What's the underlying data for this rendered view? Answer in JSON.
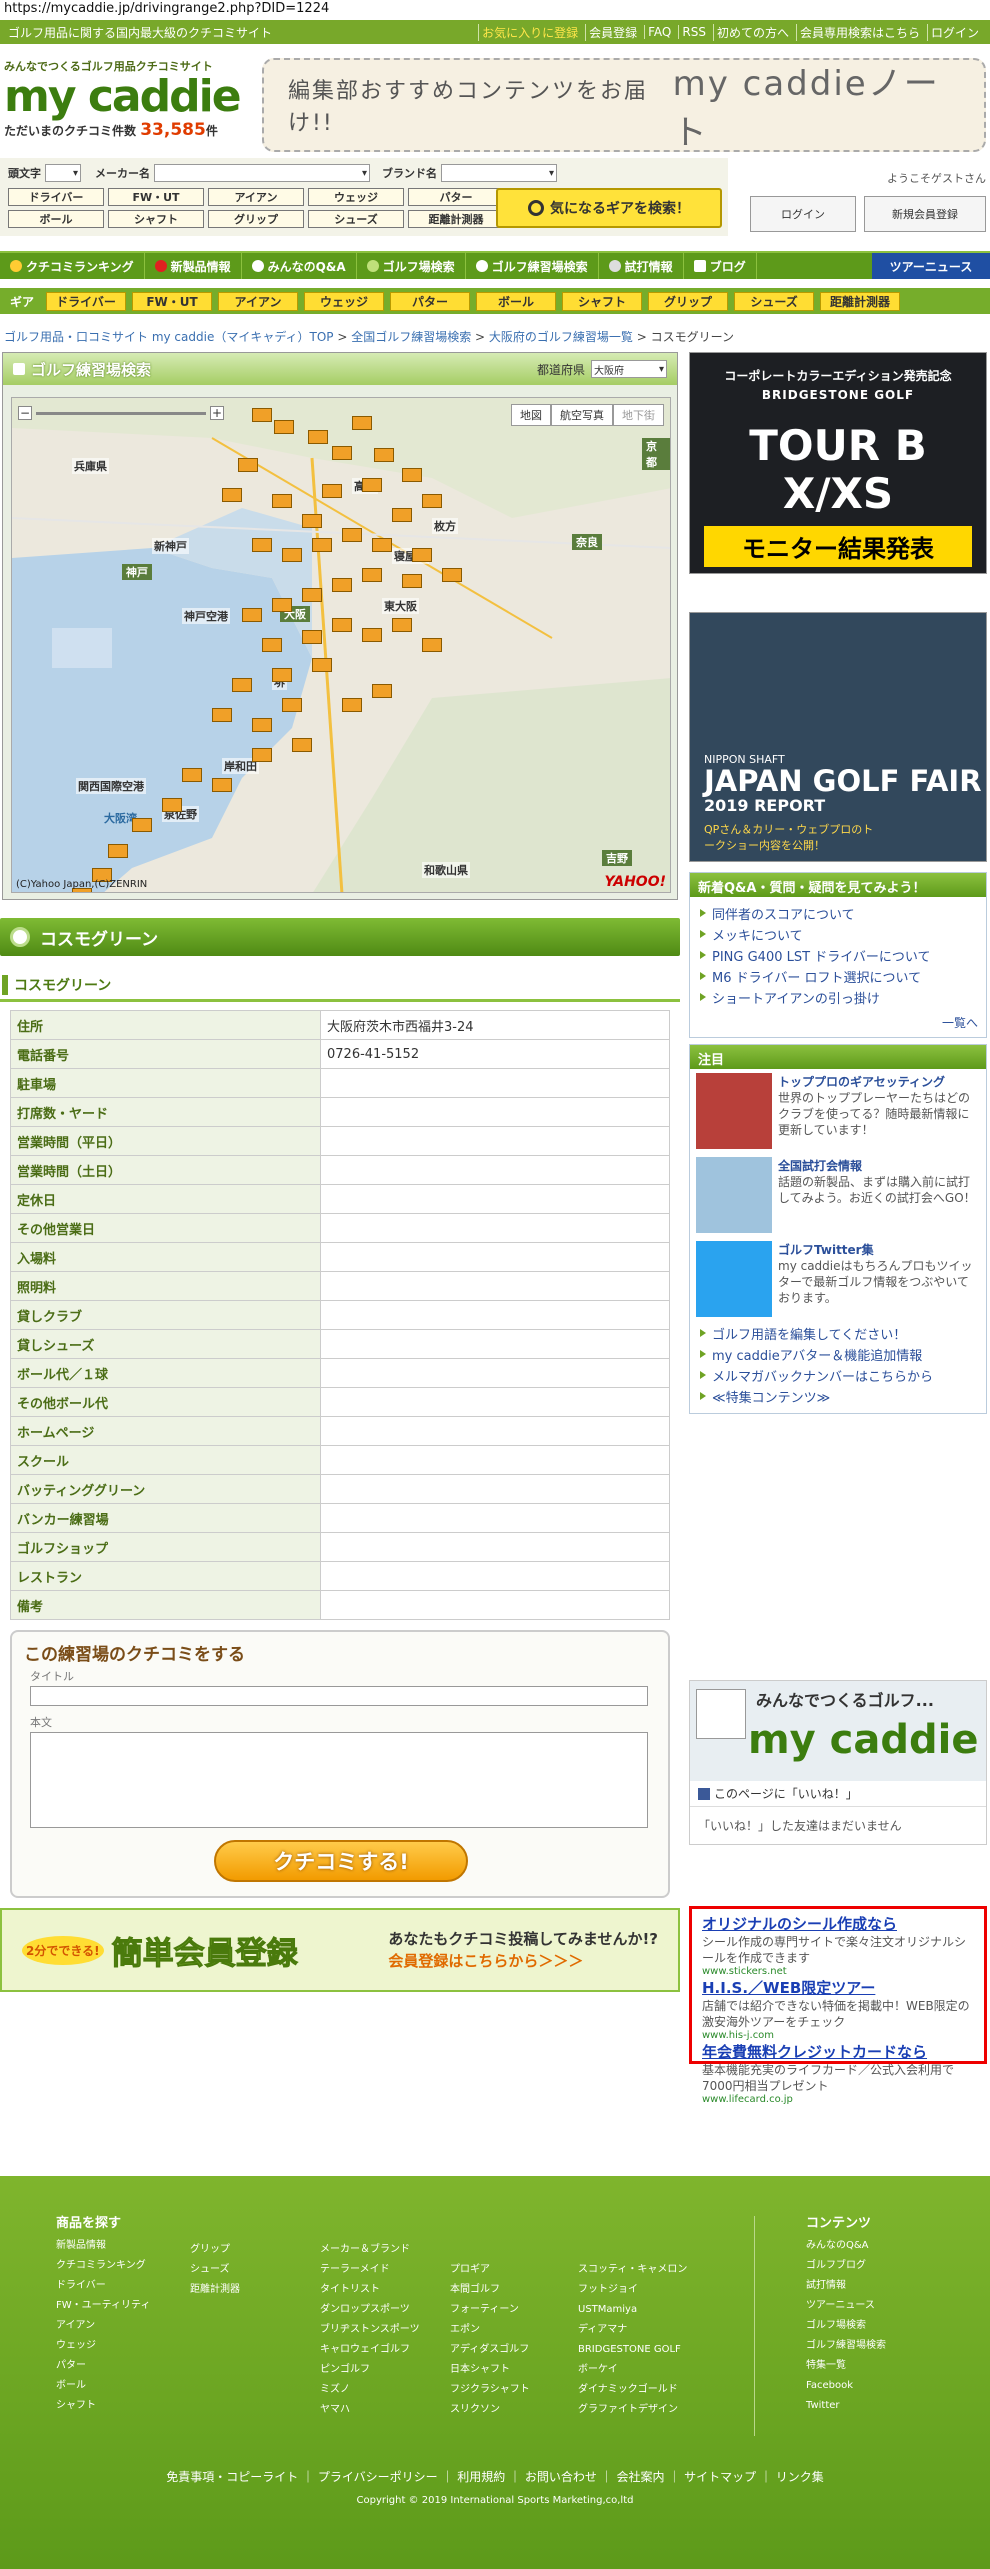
{
  "browser": {
    "url": "https://mycaddie.jp/drivingrange2.php?DID=1224"
  },
  "topbar": {
    "tagline": "ゴルフ用品に関する国内最大級のクチコミサイト",
    "links": [
      "お気に入りに登録",
      "会員登録",
      "FAQ",
      "RSS",
      "初めての方へ",
      "会員専用検索はこちら",
      "ログイン"
    ]
  },
  "logo": {
    "small": "みんなでつくるゴルフ用品クチコミサイト",
    "main": "my caddie",
    "count_label": "ただいまのクチコミ件数",
    "count": "33,585",
    "count_unit": "件"
  },
  "banner": {
    "left": "編集部おすすめコンテンツをお届け!!",
    "right": "my caddieノート"
  },
  "search": {
    "initial_label": "頭文字",
    "maker_label": "メーカー名",
    "brand_label": "ブランド名",
    "gear_row1": [
      "ドライバー",
      "FW・UT",
      "アイアン",
      "ウェッジ",
      "パター"
    ],
    "gear_row2": [
      "ボール",
      "シャフト",
      "グリップ",
      "シューズ",
      "距離計測器"
    ],
    "find_button": "気になるギアを検索！"
  },
  "user": {
    "welcome": "ようこそゲストさん",
    "login": "ログイン",
    "register": "新規会員登録"
  },
  "mainnav": [
    "クチコミランキング",
    "新製品情報",
    "みんなのQ&A",
    "ゴルフ場検索",
    "ゴルフ練習場検索",
    "試打情報",
    "ブログ",
    "ツアーニュース"
  ],
  "gearnav": {
    "label": "ギア",
    "items": [
      "ドライバー",
      "FW・UT",
      "アイアン",
      "ウェッジ",
      "パター",
      "ボール",
      "シャフト",
      "グリップ",
      "シューズ",
      "距離計測器"
    ]
  },
  "breadcrumb": [
    "ゴルフ用品・口コミサイト my caddie（マイキャディ）TOP",
    "全国ゴルフ練習場検索",
    "大阪府のゴルフ練習場一覧",
    "コスモグリーン"
  ],
  "map": {
    "title": "ゴルフ練習場検索",
    "pref_label": "都道府県",
    "pref": "大阪府",
    "modes": [
      "地図",
      "航空写真",
      "地下街"
    ],
    "labels": [
      "兵庫県",
      "京都",
      "奈良",
      "新神戸",
      "神戸",
      "大阪",
      "神戸空港",
      "関西国際空港",
      "和歌山県",
      "大阪湾",
      "堺",
      "岸和田",
      "泉佐野",
      "吉野",
      "東大阪",
      "枚方",
      "寝屋川",
      "高槻"
    ],
    "copyright": "(C)Yahoo Japan,(C)ZENRIN",
    "brand": "YAHOO!"
  },
  "section": {
    "title": "コスモグリーン",
    "subtitle": "コスモグリーン"
  },
  "info": [
    [
      "住所",
      "大阪府茨木市西福井3-24"
    ],
    [
      "電話番号",
      "0726-41-5152"
    ],
    [
      "駐車場",
      ""
    ],
    [
      "打席数・ヤード",
      ""
    ],
    [
      "営業時間（平日）",
      ""
    ],
    [
      "営業時間（土日）",
      ""
    ],
    [
      "定休日",
      ""
    ],
    [
      "その他営業日",
      ""
    ],
    [
      "入場料",
      ""
    ],
    [
      "照明料",
      ""
    ],
    [
      "貸しクラブ",
      ""
    ],
    [
      "貸しシューズ",
      ""
    ],
    [
      "ボール代／１球",
      ""
    ],
    [
      "その他ボール代",
      ""
    ],
    [
      "ホームページ",
      ""
    ],
    [
      "スクール",
      ""
    ],
    [
      "バッティンググリーン",
      ""
    ],
    [
      "バンカー練習場",
      ""
    ],
    [
      "ゴルフショップ",
      ""
    ],
    [
      "レストラン",
      ""
    ],
    [
      "備考",
      ""
    ]
  ],
  "review": {
    "heading": "この練習場のクチコミをする",
    "title_label": "タイトル",
    "body_label": "本文",
    "submit": "クチコミする!"
  },
  "register": {
    "badge": "2分でできる!",
    "main": "簡単会員登録",
    "line1": "あなたもクチコミ投稿してみませんか!?",
    "line2": "会員登録はこちらから＞＞＞"
  },
  "ads": {
    "ad1": {
      "top": "コーポレートカラーエディション発売記念",
      "brand": "BRIDGESTONE GOLF",
      "title": "TOUR B X/XS",
      "sub": "モニター結果発表"
    },
    "ad2": {
      "brand": "NIPPON SHAFT",
      "title": "JAPAN GOLF FAIR",
      "year": "2019 REPORT",
      "note": "QPさん＆カリー・ウェブプロのトークショー内容を公開！"
    }
  },
  "qa": {
    "title": "新着Q&A・質問・疑問を見てみよう！",
    "items": [
      "同伴者のスコアについて",
      "メッキについて",
      "PING G400 LST ドライバーについて",
      "M6 ドライバー ロフト選択について",
      "ショートアイアンの引っ掛け"
    ],
    "more": "一覧へ"
  },
  "pickup": {
    "title": "注目",
    "items": [
      {
        "t": "トッププロのギアセッティング",
        "d": "世界のトッププレーヤーたちはどのクラブを使ってる？随時最新情報に更新しています！"
      },
      {
        "t": "全国試打会情報",
        "d": "話題の新製品、まずは購入前に試打してみよう。お近くの試打会へGO！"
      },
      {
        "t": "ゴルフTwitter集",
        "d": "my caddieはもちろんプロもツイッターで最新ゴルフ情報をつぶやいております。"
      }
    ],
    "links": [
      "ゴルフ用語を編集してください！",
      "my caddieアバター＆機能追加情報",
      "メルマガバックナンバーはこちらから",
      "≪特集コンテンツ≫"
    ]
  },
  "facebook": {
    "banner": "みんなでつくるゴルフ...",
    "logo": "my caddie",
    "like": "このページに「いいね！」",
    "none": "「いいね！」した友達はまだいません"
  },
  "textads": [
    {
      "a": "オリジナルのシール作成なら",
      "d": "シール作成の専門サイトで楽々注文オリジナルシールを作成できます",
      "u": "www.stickers.net"
    },
    {
      "a": "H.I.S.／WEB限定ツアー",
      "d": "店舗では紹介できない特価を掲載中！WEB限定の激安海外ツアーをチェック",
      "u": "www.his-j.com"
    },
    {
      "a": "年会費無料クレジットカードなら",
      "d": "基本機能充実のライフカード／公式入会利用で7000円相当プレゼント",
      "u": "www.lifecard.co.jp"
    }
  ],
  "footer": {
    "h1": "商品を探す",
    "col1": [
      "新製品情報",
      "クチコミランキング",
      "ドライバー",
      "FW・ユーティリティ",
      "アイアン",
      "ウェッジ",
      "パター",
      "ボール",
      "シャフト"
    ],
    "col2": [
      "グリップ",
      "シューズ",
      "距離計測器"
    ],
    "brands_h": "メーカー＆ブランド",
    "col3": [
      "テーラーメイド",
      "タイトリスト",
      "ダンロップスポーツ",
      "ブリヂストンスポーツ",
      "キャロウェイゴルフ",
      "ピンゴルフ",
      "ミズノ",
      "ヤマハ"
    ],
    "col4": [
      "プロギア",
      "本間ゴルフ",
      "フォーティーン",
      "エポン",
      "アディダスゴルフ",
      "日本シャフト",
      "フジクラシャフト",
      "スリクソン"
    ],
    "col5": [
      "スコッティ・キャメロン",
      "フットジョイ",
      "USTMamiya",
      "ディアマナ",
      "BRIDGESTONE GOLF",
      "ボーケイ",
      "ダイナミックゴールド",
      "グラファイトデザイン"
    ],
    "h2": "コンテンツ",
    "col6": [
      "みんなのQ&A",
      "ゴルフブログ",
      "試打情報",
      "ツアーニュース",
      "ゴルフ場検索",
      "ゴルフ練習場検索",
      "特集一覧",
      "Facebook",
      "Twitter"
    ],
    "bottom": "免責事項・コピーライト ｜ プライバシーポリシー ｜ 利用規約 ｜ お問い合わせ ｜ 会社案内 ｜ サイトマップ ｜ リンク集",
    "copyright": "Copyright © 2019 International Sports Marketing,co,ltd"
  }
}
